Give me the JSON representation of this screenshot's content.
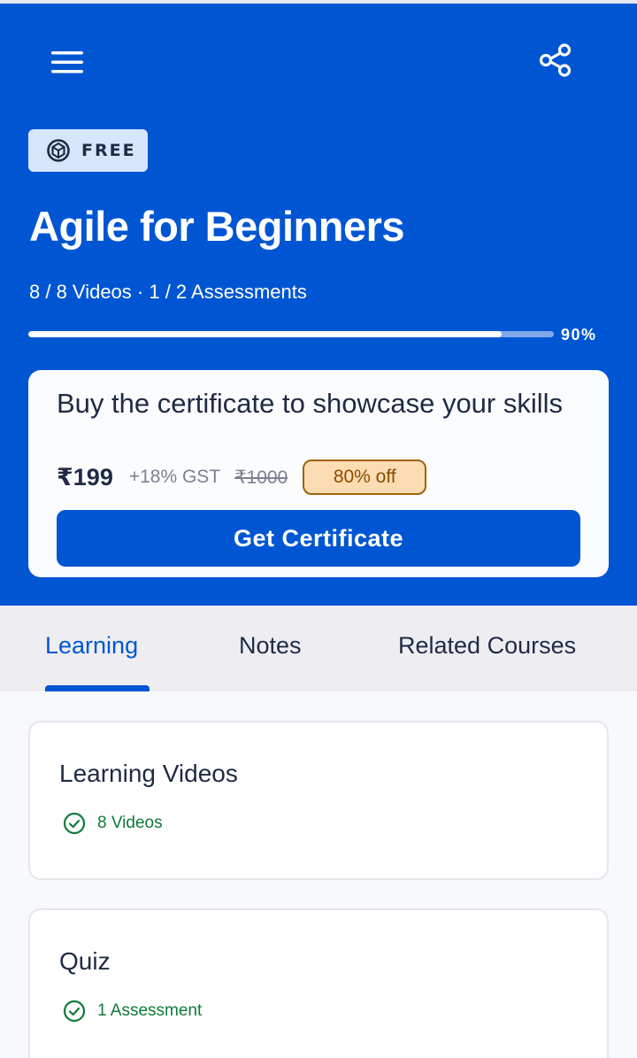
{
  "course": {
    "badge": "FREE",
    "title": "Agile for Beginners",
    "meta": "8 / 8 Videos · 1 / 2 Assessments",
    "progress_percent": 90,
    "progress_label": "90%"
  },
  "certificate": {
    "heading": "Buy the certificate to showcase your skills",
    "price": "₹199",
    "gst": "+18% GST",
    "old_price": "₹1000",
    "discount": "80% off",
    "button": "Get Certificate"
  },
  "tabs": [
    {
      "label": "Learning",
      "active": true
    },
    {
      "label": "Notes",
      "active": false
    },
    {
      "label": "Related Courses",
      "active": false
    }
  ],
  "sections": [
    {
      "title": "Learning Videos",
      "status": "8 Videos"
    },
    {
      "title": "Quiz",
      "status": "1 Assessment"
    }
  ],
  "icons": {
    "menu": "hamburger-menu-icon",
    "share": "share-icon",
    "badge": "course-logo-icon",
    "check": "check-circle-icon"
  },
  "colors": {
    "brand": "#0056d2",
    "success": "#0f7a3a",
    "discount_bg": "#fbdcb3",
    "discount_border": "#a0620b"
  }
}
